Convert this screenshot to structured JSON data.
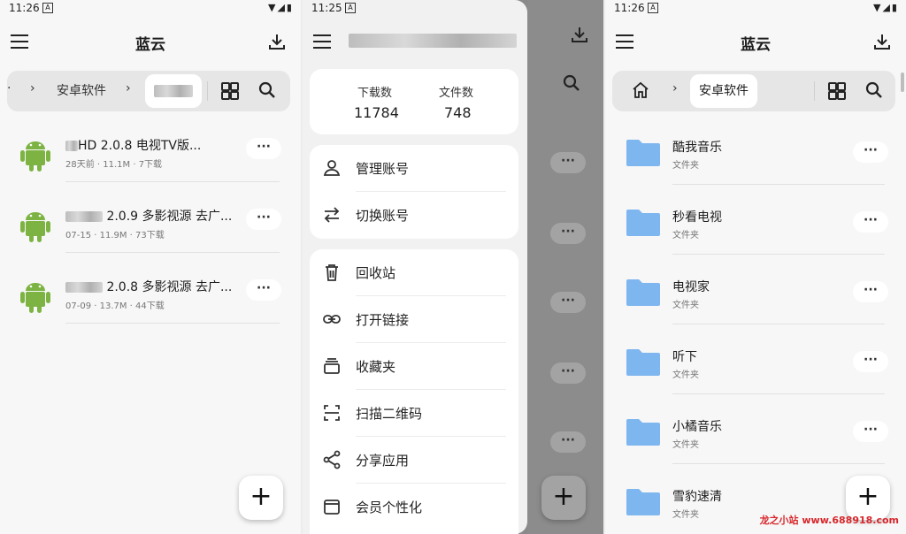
{
  "screen1": {
    "time": "11:26",
    "title": "蓝云",
    "breadcrumb": {
      "item": "安卓软件"
    },
    "files": [
      {
        "name": "HD 2.0.8 电视TV版...",
        "meta": "28天前 · 11.1M · 7下载"
      },
      {
        "name": "2.0.9 多影视源 去广...",
        "meta": "07-15 · 11.9M · 73下载"
      },
      {
        "name": "2.0.8 多影视源 去广...",
        "meta": "07-09 · 13.7M · 44下载"
      }
    ],
    "more_label": "···",
    "fab_label": "+"
  },
  "screen2": {
    "time": "11:25",
    "stats": [
      {
        "label": "下载数",
        "value": "11784"
      },
      {
        "label": "文件数",
        "value": "748"
      }
    ],
    "account_menu": [
      {
        "label": "管理账号",
        "icon": "person-icon"
      },
      {
        "label": "切换账号",
        "icon": "swap-icon"
      }
    ],
    "main_menu": [
      {
        "label": "回收站",
        "icon": "trash-icon"
      },
      {
        "label": "打开链接",
        "icon": "link-icon"
      },
      {
        "label": "收藏夹",
        "icon": "collection-icon"
      },
      {
        "label": "扫描二维码",
        "icon": "scan-icon"
      },
      {
        "label": "分享应用",
        "icon": "share-icon"
      },
      {
        "label": "会员个性化",
        "icon": "wallet-icon"
      }
    ],
    "more_label": "···",
    "fab_label": "+"
  },
  "screen3": {
    "time": "11:26",
    "title": "蓝云",
    "breadcrumb": {
      "item": "安卓软件"
    },
    "folders": [
      {
        "name": "酷我音乐",
        "type": "文件夹"
      },
      {
        "name": "秒看电视",
        "type": "文件夹"
      },
      {
        "name": "电视家",
        "type": "文件夹"
      },
      {
        "name": "听下",
        "type": "文件夹"
      },
      {
        "name": "小橘音乐",
        "type": "文件夹"
      },
      {
        "name": "雪豹速清",
        "type": "文件夹"
      }
    ],
    "more_label": "···",
    "fab_label": "+"
  },
  "watermark": "龙之小站 www.688918.com",
  "colors": {
    "android_green": "#7cb342",
    "folder_blue": "#7eb6f0",
    "watermark_red": "#d8262b"
  }
}
